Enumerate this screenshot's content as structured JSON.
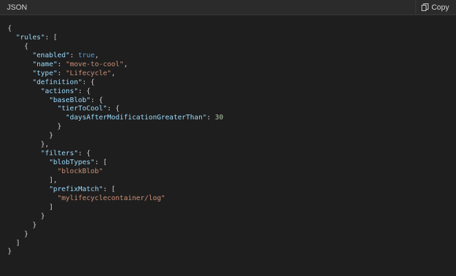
{
  "header": {
    "language": "JSON",
    "copy_label": "Copy"
  },
  "code_lines": [
    [
      {
        "t": "{",
        "c": "punct"
      }
    ],
    [
      {
        "t": "  ",
        "c": "punct"
      },
      {
        "t": "\"rules\"",
        "c": "key"
      },
      {
        "t": ": [",
        "c": "punct"
      }
    ],
    [
      {
        "t": "    {",
        "c": "punct"
      }
    ],
    [
      {
        "t": "      ",
        "c": "punct"
      },
      {
        "t": "\"enabled\"",
        "c": "key"
      },
      {
        "t": ": ",
        "c": "punct"
      },
      {
        "t": "true",
        "c": "bool"
      },
      {
        "t": ",",
        "c": "punct"
      }
    ],
    [
      {
        "t": "      ",
        "c": "punct"
      },
      {
        "t": "\"name\"",
        "c": "key"
      },
      {
        "t": ": ",
        "c": "punct"
      },
      {
        "t": "\"move-to-cool\"",
        "c": "str"
      },
      {
        "t": ",",
        "c": "punct"
      }
    ],
    [
      {
        "t": "      ",
        "c": "punct"
      },
      {
        "t": "\"type\"",
        "c": "key"
      },
      {
        "t": ": ",
        "c": "punct"
      },
      {
        "t": "\"Lifecycle\"",
        "c": "str"
      },
      {
        "t": ",",
        "c": "punct"
      }
    ],
    [
      {
        "t": "      ",
        "c": "punct"
      },
      {
        "t": "\"definition\"",
        "c": "key"
      },
      {
        "t": ": {",
        "c": "punct"
      }
    ],
    [
      {
        "t": "        ",
        "c": "punct"
      },
      {
        "t": "\"actions\"",
        "c": "key"
      },
      {
        "t": ": {",
        "c": "punct"
      }
    ],
    [
      {
        "t": "          ",
        "c": "punct"
      },
      {
        "t": "\"baseBlob\"",
        "c": "key"
      },
      {
        "t": ": {",
        "c": "punct"
      }
    ],
    [
      {
        "t": "            ",
        "c": "punct"
      },
      {
        "t": "\"tierToCool\"",
        "c": "key"
      },
      {
        "t": ": {",
        "c": "punct"
      }
    ],
    [
      {
        "t": "              ",
        "c": "punct"
      },
      {
        "t": "\"daysAfterModificationGreaterThan\"",
        "c": "key"
      },
      {
        "t": ": ",
        "c": "punct"
      },
      {
        "t": "30",
        "c": "num"
      }
    ],
    [
      {
        "t": "            }",
        "c": "punct"
      }
    ],
    [
      {
        "t": "          }",
        "c": "punct"
      }
    ],
    [
      {
        "t": "        },",
        "c": "punct"
      }
    ],
    [
      {
        "t": "        ",
        "c": "punct"
      },
      {
        "t": "\"filters\"",
        "c": "key"
      },
      {
        "t": ": {",
        "c": "punct"
      }
    ],
    [
      {
        "t": "          ",
        "c": "punct"
      },
      {
        "t": "\"blobTypes\"",
        "c": "key"
      },
      {
        "t": ": [",
        "c": "punct"
      }
    ],
    [
      {
        "t": "            ",
        "c": "punct"
      },
      {
        "t": "\"blockBlob\"",
        "c": "str"
      }
    ],
    [
      {
        "t": "          ],",
        "c": "punct"
      }
    ],
    [
      {
        "t": "          ",
        "c": "punct"
      },
      {
        "t": "\"prefixMatch\"",
        "c": "key"
      },
      {
        "t": ": [",
        "c": "punct"
      }
    ],
    [
      {
        "t": "            ",
        "c": "punct"
      },
      {
        "t": "\"mylifecyclecontainer/log\"",
        "c": "str"
      }
    ],
    [
      {
        "t": "          ]",
        "c": "punct"
      }
    ],
    [
      {
        "t": "        }",
        "c": "punct"
      }
    ],
    [
      {
        "t": "      }",
        "c": "punct"
      }
    ],
    [
      {
        "t": "    }",
        "c": "punct"
      }
    ],
    [
      {
        "t": "  ]",
        "c": "punct"
      }
    ],
    [
      {
        "t": "}",
        "c": "punct"
      }
    ]
  ],
  "colors": {
    "background": "#1e1e1e",
    "header_background": "#2b2b2b",
    "key": "#9cdcfe",
    "string": "#ce9178",
    "boolean": "#569cd6",
    "number": "#b5cea8",
    "punctuation": "#d4d4d4"
  },
  "icons": {
    "copy": "copy-icon"
  }
}
